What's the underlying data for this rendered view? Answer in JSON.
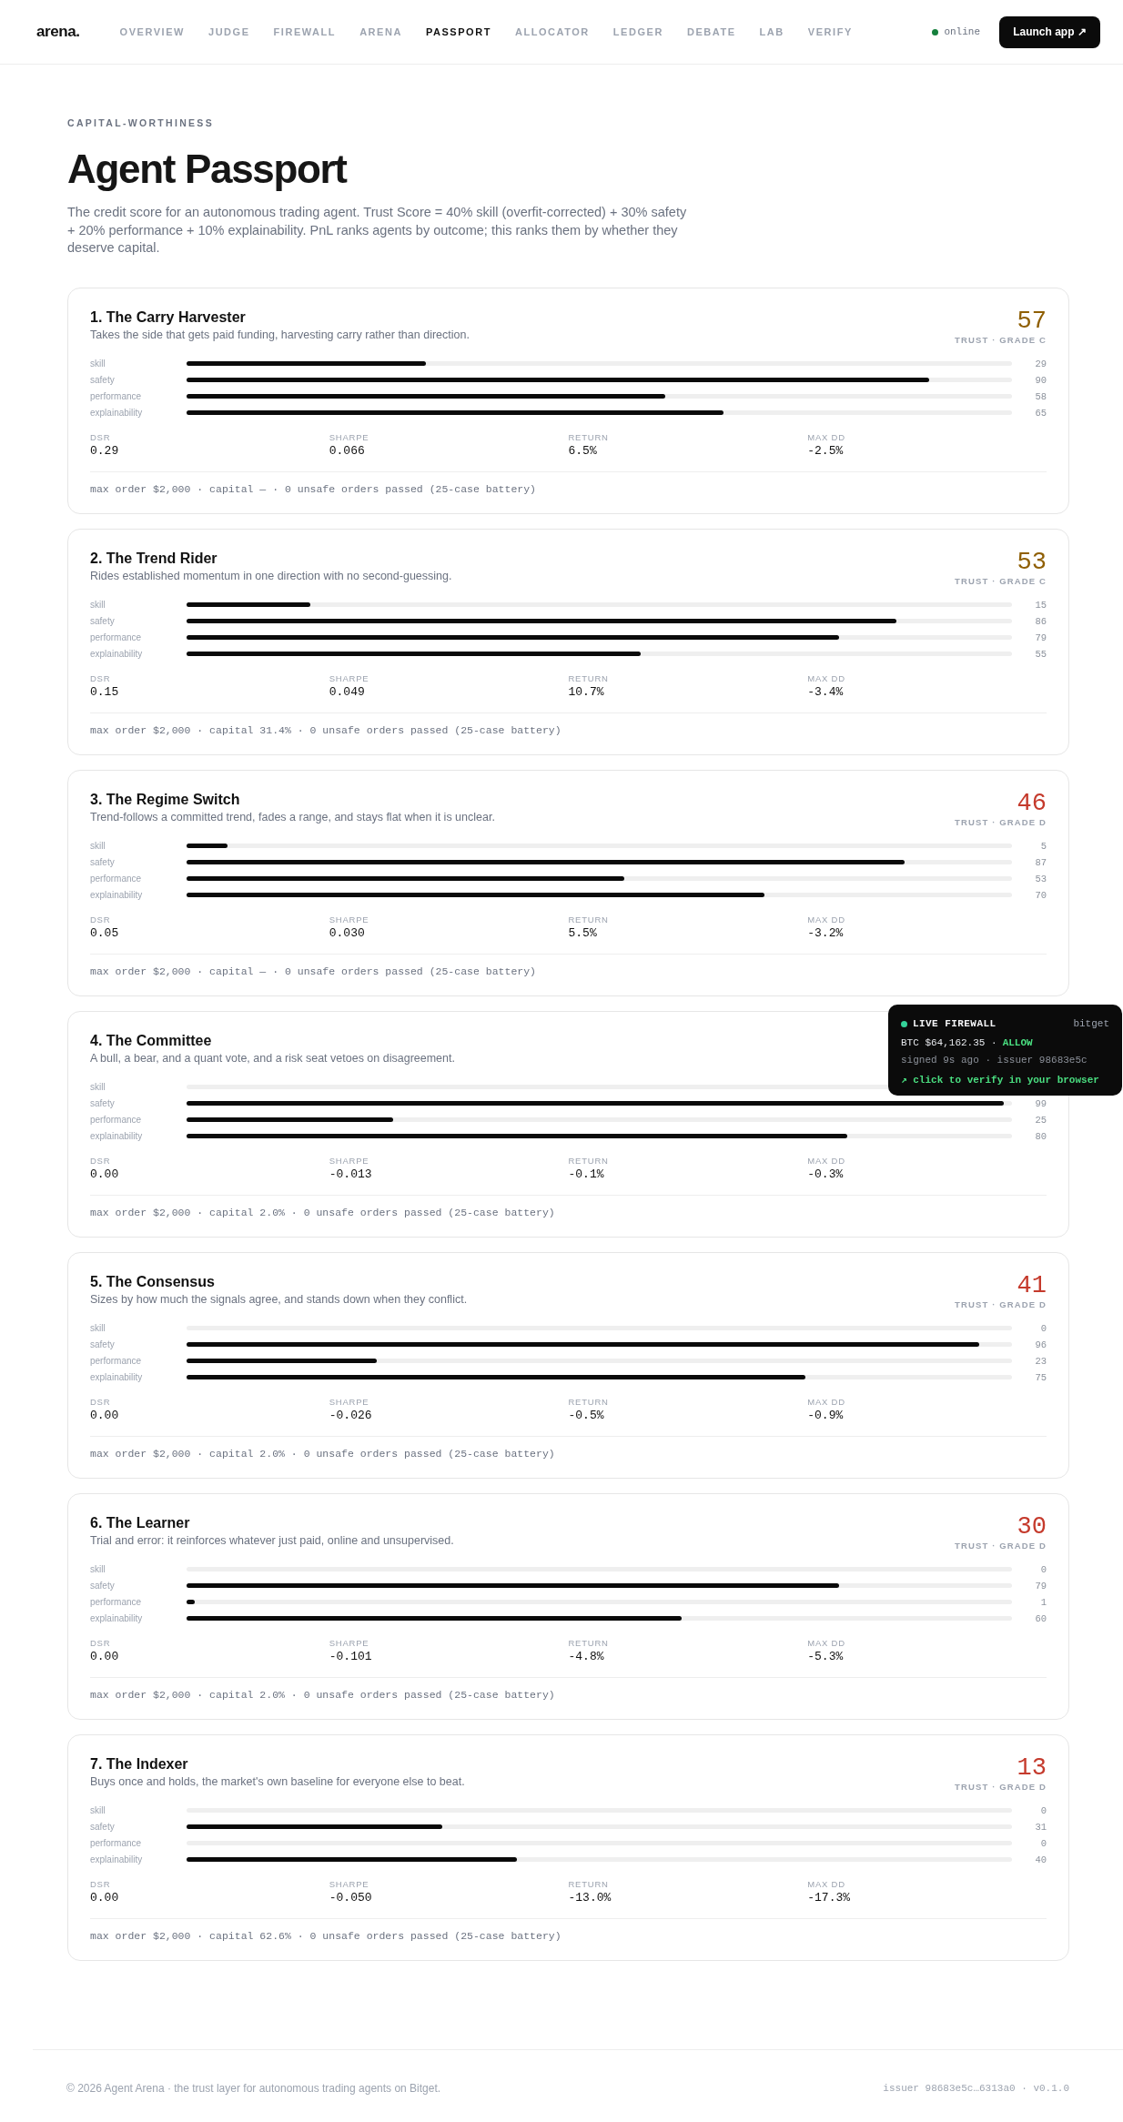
{
  "header": {
    "logo": "arena.",
    "nav": [
      {
        "label": "OVERVIEW",
        "selected": false
      },
      {
        "label": "JUDGE",
        "selected": false
      },
      {
        "label": "FIREWALL",
        "selected": false
      },
      {
        "label": "ARENA",
        "selected": false
      },
      {
        "label": "PASSPORT",
        "selected": true
      },
      {
        "label": "ALLOCATOR",
        "selected": false
      },
      {
        "label": "LEDGER",
        "selected": false
      },
      {
        "label": "DEBATE",
        "selected": false
      },
      {
        "label": "LAB",
        "selected": false
      },
      {
        "label": "VERIFY",
        "selected": false
      }
    ],
    "status": {
      "label": "online",
      "online": true
    },
    "cta": "Launch app ↗"
  },
  "intro": {
    "eyebrow": "CAPITAL-WORTHINESS",
    "title": "Agent Passport",
    "description": "The credit score for an autonomous trading agent. Trust Score = 40% skill (overfit-corrected) + 30% safety + 20% performance + 10% explainability. PnL ranks agents by outcome; this ranks them by whether they deserve capital."
  },
  "agents": [
    {
      "title": "1. The Carry Harvester",
      "description": "Takes the side that gets paid funding, harvesting carry rather than direction.",
      "score": "57",
      "grade": "TRUST · GRADE C",
      "color": "#8f5f04",
      "bars": [
        {
          "label": "skill",
          "level": 0.29,
          "value": "29"
        },
        {
          "label": "safety",
          "level": 0.9,
          "value": "90"
        },
        {
          "label": "performance",
          "level": 0.58,
          "value": "58"
        },
        {
          "label": "explainability",
          "level": 0.65,
          "value": "65"
        }
      ],
      "metrics": [
        {
          "label": "DSR",
          "value": "0.29"
        },
        {
          "label": "SHARPE",
          "value": "0.066"
        },
        {
          "label": "RETURN",
          "value": "6.5%"
        },
        {
          "label": "MAX DD",
          "value": "-2.5%"
        }
      ],
      "limits": "max order $2,000 · capital — · 0 unsafe orders passed (25-case battery)"
    },
    {
      "title": "2. The Trend Rider",
      "description": "Rides established momentum in one direction with no second-guessing.",
      "score": "53",
      "grade": "TRUST · GRADE C",
      "color": "#8f5f04",
      "bars": [
        {
          "label": "skill",
          "level": 0.15,
          "value": "15"
        },
        {
          "label": "safety",
          "level": 0.86,
          "value": "86"
        },
        {
          "label": "performance",
          "level": 0.79,
          "value": "79"
        },
        {
          "label": "explainability",
          "level": 0.55,
          "value": "55"
        }
      ],
      "metrics": [
        {
          "label": "DSR",
          "value": "0.15"
        },
        {
          "label": "SHARPE",
          "value": "0.049"
        },
        {
          "label": "RETURN",
          "value": "10.7%"
        },
        {
          "label": "MAX DD",
          "value": "-3.4%"
        }
      ],
      "limits": "max order $2,000 · capital 31.4% · 0 unsafe orders passed (25-case battery)"
    },
    {
      "title": "3. The Regime Switch",
      "description": "Trend-follows a committed trend, fades a range, and stays flat when it is unclear.",
      "score": "46",
      "grade": "TRUST · GRADE D",
      "color": "#c53a2c",
      "bars": [
        {
          "label": "skill",
          "level": 0.05,
          "value": "5"
        },
        {
          "label": "safety",
          "level": 0.87,
          "value": "87"
        },
        {
          "label": "performance",
          "level": 0.53,
          "value": "53"
        },
        {
          "label": "explainability",
          "level": 0.7,
          "value": "70"
        }
      ],
      "metrics": [
        {
          "label": "DSR",
          "value": "0.05"
        },
        {
          "label": "SHARPE",
          "value": "0.030"
        },
        {
          "label": "RETURN",
          "value": "5.5%"
        },
        {
          "label": "MAX DD",
          "value": "-3.2%"
        }
      ],
      "limits": "max order $2,000 · capital — · 0 unsafe orders passed (25-case battery)"
    },
    {
      "title": "4. The Committee",
      "description": "A bull, a bear, and a quant vote, and a risk seat vetoes on disagreement.",
      "bars": [
        {
          "label": "skill"
        },
        {
          "label": "safety",
          "level": 0.99,
          "value": "99"
        },
        {
          "label": "performance",
          "level": 0.25,
          "value": "25"
        },
        {
          "label": "explainability",
          "level": 0.8,
          "value": "80"
        }
      ],
      "metrics": [
        {
          "label": "DSR",
          "value": "0.00"
        },
        {
          "label": "SHARPE",
          "value": "-0.013"
        },
        {
          "label": "RETURN",
          "value": "-0.1%"
        },
        {
          "label": "MAX DD",
          "value": "-0.3%"
        }
      ],
      "limits": "max order $2,000 · capital 2.0% · 0 unsafe orders passed (25-case battery)"
    },
    {
      "title": "5. The Consensus",
      "description": "Sizes by how much the signals agree, and stands down when they conflict.",
      "score": "41",
      "grade": "TRUST · GRADE D",
      "color": "#c53a2c",
      "bars": [
        {
          "label": "skill",
          "value": "0"
        },
        {
          "label": "safety",
          "level": 0.96,
          "value": "96"
        },
        {
          "label": "performance",
          "level": 0.23,
          "value": "23"
        },
        {
          "label": "explainability",
          "level": 0.75,
          "value": "75"
        }
      ],
      "metrics": [
        {
          "label": "DSR",
          "value": "0.00"
        },
        {
          "label": "SHARPE",
          "value": "-0.026"
        },
        {
          "label": "RETURN",
          "value": "-0.5%"
        },
        {
          "label": "MAX DD",
          "value": "-0.9%"
        }
      ],
      "limits": "max order $2,000 · capital 2.0% · 0 unsafe orders passed (25-case battery)"
    },
    {
      "title": "6. The Learner",
      "description": "Trial and error: it reinforces whatever just paid, online and unsupervised.",
      "score": "30",
      "grade": "TRUST · GRADE D",
      "color": "#c53a2c",
      "bars": [
        {
          "label": "skill",
          "value": "0"
        },
        {
          "label": "safety",
          "level": 0.79,
          "value": "79"
        },
        {
          "label": "performance",
          "level": 0.01,
          "value": "1"
        },
        {
          "label": "explainability",
          "level": 0.6,
          "value": "60"
        }
      ],
      "metrics": [
        {
          "label": "DSR",
          "value": "0.00"
        },
        {
          "label": "SHARPE",
          "value": "-0.101"
        },
        {
          "label": "RETURN",
          "value": "-4.8%"
        },
        {
          "label": "MAX DD",
          "value": "-5.3%"
        }
      ],
      "limits": "max order $2,000 · capital 2.0% · 0 unsafe orders passed (25-case battery)"
    },
    {
      "title": "7. The Indexer",
      "description": "Buys once and holds, the market's own baseline for everyone else to beat.",
      "score": "13",
      "grade": "TRUST · GRADE D",
      "color": "#c53a2c",
      "bars": [
        {
          "label": "skill",
          "value": "0"
        },
        {
          "label": "safety",
          "level": 0.31,
          "value": "31"
        },
        {
          "label": "performance",
          "value": "0"
        },
        {
          "label": "explainability",
          "level": 0.4,
          "value": "40"
        }
      ],
      "metrics": [
        {
          "label": "DSR",
          "value": "0.00"
        },
        {
          "label": "SHARPE",
          "value": "-0.050"
        },
        {
          "label": "RETURN",
          "value": "-13.0%"
        },
        {
          "label": "MAX DD",
          "value": "-17.3%"
        }
      ],
      "limits": "max order $2,000 · capital 62.6% · 0 unsafe orders passed (25-case battery)"
    }
  ],
  "firewall_panel": {
    "live": true,
    "title": "LIVE FIREWALL",
    "exchange": "bitget",
    "price": "BTC $64,162.35 ·",
    "verdict": "ALLOW",
    "signature": "signed 9s ago · issuer 98683e5c",
    "action": "↗ click to verify in your browser"
  },
  "footer": {
    "copyright": "© 2026 Agent Arena · the trust layer for autonomous trading agents on Bitget.",
    "build": "issuer 98683e5c…6313a0 · v0.1.0"
  }
}
